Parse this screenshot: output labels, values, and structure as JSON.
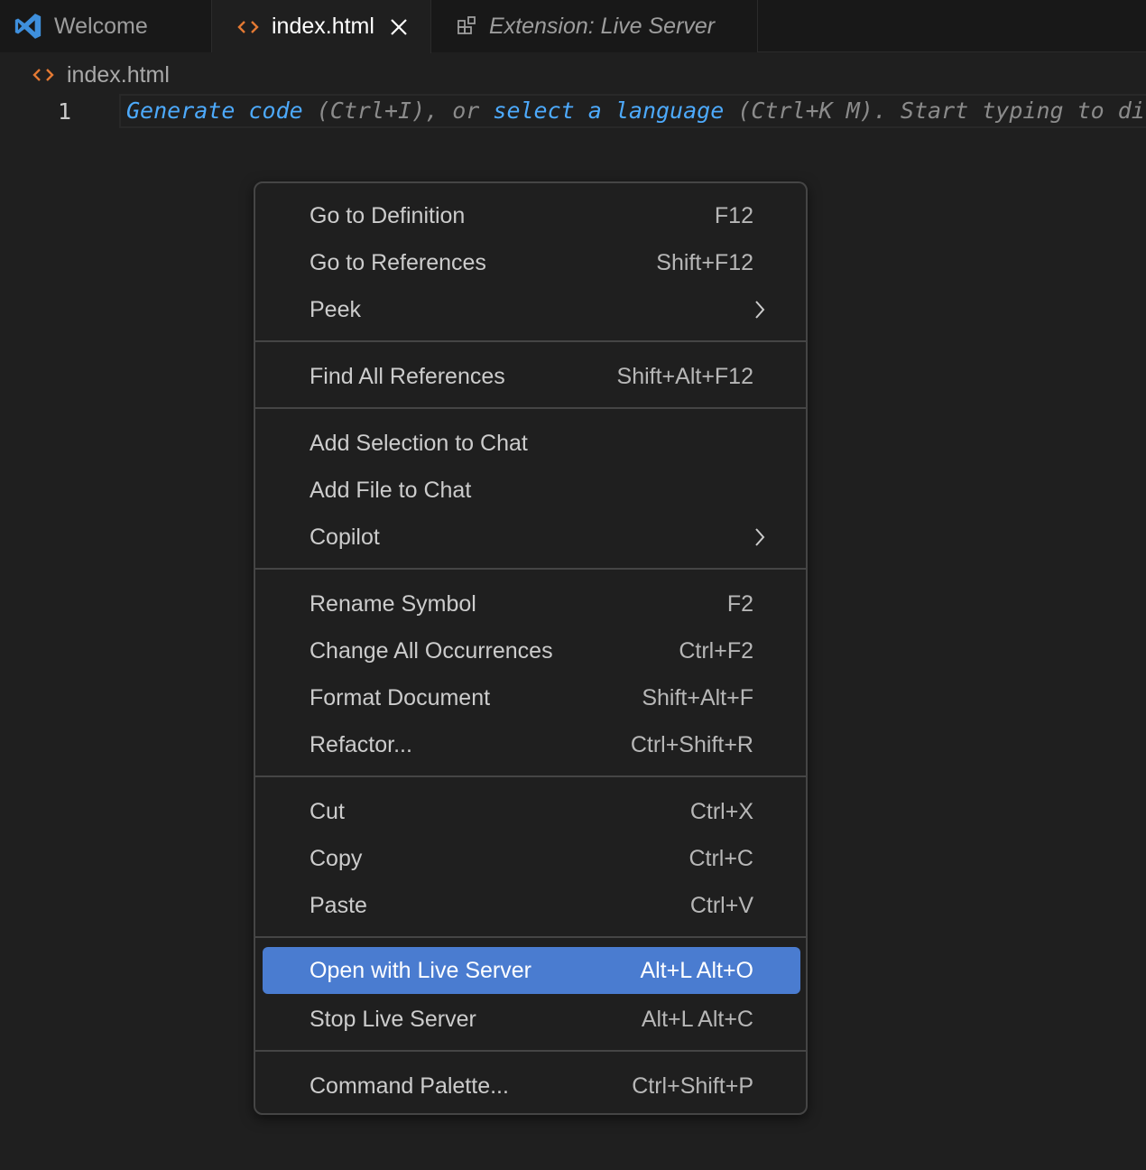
{
  "tabs": [
    {
      "label": "Welcome",
      "icon": "vscode-logo-icon",
      "active": false
    },
    {
      "label": "index.html",
      "icon": "html-code-icon",
      "active": true,
      "close_icon": "close-icon"
    },
    {
      "label": "Extension: Live Server",
      "icon": "extensions-icon",
      "active": false,
      "italic": true
    }
  ],
  "breadcrumb": {
    "icon": "html-code-icon",
    "file": "index.html"
  },
  "editor": {
    "line_number": "1",
    "hint": {
      "link1": "Generate code",
      "text1": " (Ctrl+I), or ",
      "link2": "select a language",
      "text2": " (Ctrl+K M). Start typing to dismiss."
    }
  },
  "context_menu": {
    "items": [
      {
        "label": "Go to Definition",
        "shortcut": "F12"
      },
      {
        "label": "Go to References",
        "shortcut": "Shift+F12"
      },
      {
        "label": "Peek",
        "submenu": true
      },
      {
        "label": "Find All References",
        "shortcut": "Shift+Alt+F12"
      },
      {
        "label": "Add Selection to Chat"
      },
      {
        "label": "Add File to Chat"
      },
      {
        "label": "Copilot",
        "submenu": true
      },
      {
        "label": "Rename Symbol",
        "shortcut": "F2"
      },
      {
        "label": "Change All Occurrences",
        "shortcut": "Ctrl+F2"
      },
      {
        "label": "Format Document",
        "shortcut": "Shift+Alt+F"
      },
      {
        "label": "Refactor...",
        "shortcut": "Ctrl+Shift+R"
      },
      {
        "label": "Cut",
        "shortcut": "Ctrl+X"
      },
      {
        "label": "Copy",
        "shortcut": "Ctrl+C"
      },
      {
        "label": "Paste",
        "shortcut": "Ctrl+V"
      },
      {
        "label": "Open with Live Server",
        "shortcut": "Alt+L Alt+O",
        "highlighted": true
      },
      {
        "label": "Stop Live Server",
        "shortcut": "Alt+L Alt+C"
      },
      {
        "label": "Command Palette...",
        "shortcut": "Ctrl+Shift+P"
      }
    ]
  },
  "colors": {
    "background": "#1f1f1f",
    "tabbar": "#181818",
    "accent_highlight": "#4a7cd0",
    "hint_link": "#4daafc",
    "html_icon": "#e37933",
    "vscode_logo": "#3e8fdc"
  }
}
